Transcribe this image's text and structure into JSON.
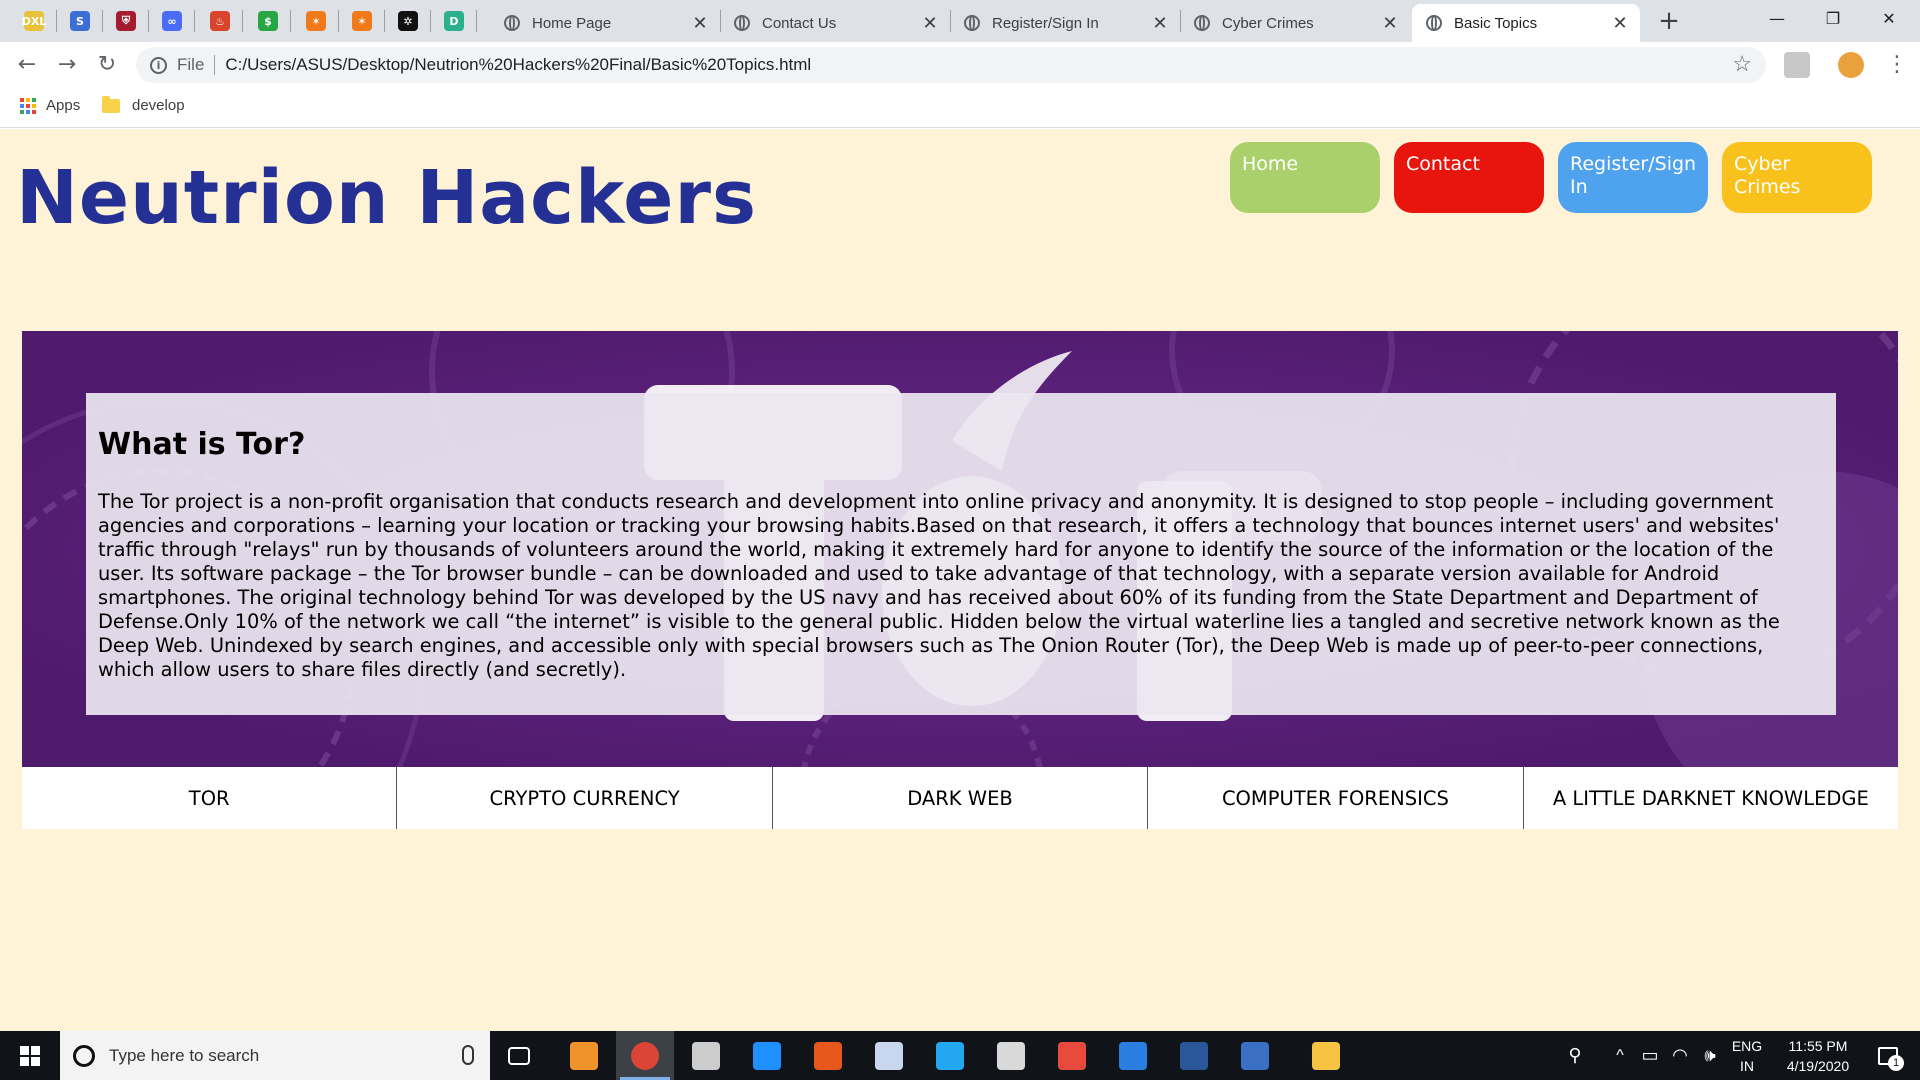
{
  "browser": {
    "pinned_tabs": [
      {
        "name": "excel-icon",
        "color": "#e8c23a",
        "glyph": "DXL"
      },
      {
        "name": "s-circle-icon",
        "color": "#3b6fd4",
        "glyph": "S"
      },
      {
        "name": "harvard-shield-icon",
        "color": "#a51c30",
        "glyph": "⛨"
      },
      {
        "name": "infinity-icon",
        "color": "#4a6cf7",
        "glyph": "∞"
      },
      {
        "name": "brand-icon",
        "color": "#d9442c",
        "glyph": "♨"
      },
      {
        "name": "dollar-circle-icon",
        "color": "#27a744",
        "glyph": "$"
      },
      {
        "name": "orange-star-icon",
        "color": "#f07a1a",
        "glyph": "✶"
      },
      {
        "name": "orange-star-icon-2",
        "color": "#f07a1a",
        "glyph": "✶"
      },
      {
        "name": "gear-circle-icon",
        "color": "#111111",
        "glyph": "✲"
      },
      {
        "name": "d-square-icon",
        "color": "#2bb08d",
        "glyph": "D"
      }
    ],
    "tabs": [
      {
        "title": "Home Page",
        "active": false
      },
      {
        "title": "Contact Us",
        "active": false
      },
      {
        "title": "Register/Sign In",
        "active": false
      },
      {
        "title": "Cyber Crimes",
        "active": false
      },
      {
        "title": "Basic Topics",
        "active": true
      }
    ],
    "tab_close_glyph": "✕",
    "new_tab_glyph": "+",
    "window_controls": {
      "minimize": "—",
      "maximize": "❐",
      "close": "✕"
    },
    "nav": {
      "back": "←",
      "forward": "→",
      "reload": "↻"
    },
    "omnibox": {
      "info_glyph": "i",
      "scheme_label": "File",
      "url": "C:/Users/ASUS/Desktop/Neutrion%20Hackers%20Final/Basic%20Topics.html",
      "star_glyph": "☆"
    },
    "menu_glyph": "⋮",
    "bookmarks": [
      {
        "label": "Apps",
        "icon": "apps-grid-icon"
      },
      {
        "label": "develop",
        "icon": "folder-icon"
      }
    ]
  },
  "page": {
    "site_title": "Neutrion Hackers",
    "nav_buttons": [
      {
        "label": "Home",
        "color": "#a9d06a"
      },
      {
        "label": "Contact",
        "color": "#e8140e"
      },
      {
        "label": "Register/Sign In",
        "color": "#4fa3ee"
      },
      {
        "label": "Cyber Crimes",
        "color": "#f9c11c"
      }
    ],
    "hero": {
      "background_color": "#5a1f7a",
      "watermark": "Tor",
      "heading": "What is Tor?",
      "body": "The Tor project is a non-profit organisation that conducts research and development into online privacy and anonymity. It is designed to stop people – including government agencies and corporations – learning your location or tracking your browsing habits.Based on that research, it offers a technology that bounces internet users' and websites' traffic through \"relays\" run by thousands of volunteers around the world, making it extremely hard for anyone to identify the source of the information or the location of the user. Its software package – the Tor browser bundle – can be downloaded and used to take advantage of that technology, with a separate version available for Android smartphones. The original technology behind Tor was developed by the US navy and has received about 60% of its funding from the State Department and Department of Defense.Only 10% of the network we call “the internet” is visible to the general public. Hidden below the virtual waterline lies a tangled and secretive network known as the Deep Web. Unindexed by search engines, and accessible only with special browsers such as The Onion Router (Tor), the Deep Web is made up of peer-to-peer connections, which allow users to share files directly (and secretly)."
    },
    "topics": [
      "TOR",
      "CRYPTO CURRENCY",
      "DARK WEB",
      "COMPUTER FORENSICS",
      "A LITTLE DARKNET KNOWLEDGE"
    ],
    "background_color": "#fff3d7",
    "title_color": "#253095"
  },
  "taskbar": {
    "search_placeholder": "Type here to search",
    "apps": [
      {
        "name": "task-view-icon",
        "color": "#ffffff",
        "active": false
      },
      {
        "name": "sublime-text-icon",
        "color": "#f0932b",
        "active": false
      },
      {
        "name": "chrome-icon",
        "color": "#db4437",
        "active": true
      },
      {
        "name": "terminal-icon",
        "color": "#cccccc",
        "active": false
      },
      {
        "name": "app-blue-icon",
        "color": "#1e90ff",
        "active": false
      },
      {
        "name": "pms-icon",
        "color": "#e8581c",
        "active": false
      },
      {
        "name": "virtualbox-icon",
        "color": "#c9d6f0",
        "active": false
      },
      {
        "name": "vscode-icon",
        "color": "#23a7f0",
        "active": false
      },
      {
        "name": "printer-icon",
        "color": "#d9d9d9",
        "active": false
      },
      {
        "name": "snipping-tool-icon",
        "color": "#e84b3c",
        "active": false
      },
      {
        "name": "wing-app-icon",
        "color": "#2a7de1",
        "active": false
      },
      {
        "name": "word-icon",
        "color": "#2b579a",
        "active": false
      },
      {
        "name": "dev-cpp-icon",
        "color": "#3a6fc4",
        "active": false
      },
      {
        "name": "file-explorer-icon",
        "color": "#f6c343",
        "active": false
      }
    ],
    "tray": {
      "people_glyph": "⚲",
      "chevron_glyph": "^",
      "battery_glyph": "▭",
      "wifi_glyph": "◠",
      "volume_glyph": "🕪",
      "language": "ENG",
      "region": "IN",
      "time": "11:55 PM",
      "date": "4/19/2020",
      "notification_count": "1"
    }
  }
}
